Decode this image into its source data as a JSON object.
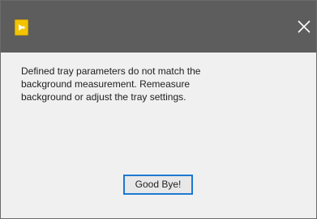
{
  "dialog": {
    "message": "Defined tray parameters do not match the\nbackground measurement.  Remeasure\nbackground or adjust the tray settings.",
    "button_label": "Good Bye!",
    "close_glyph": "✕"
  },
  "colors": {
    "titlebar": "#5d5d5d",
    "icon": "#f2c400",
    "button_border": "#1d78d2"
  },
  "icons": {
    "app": "labview-app-icon",
    "close": "close-icon"
  }
}
